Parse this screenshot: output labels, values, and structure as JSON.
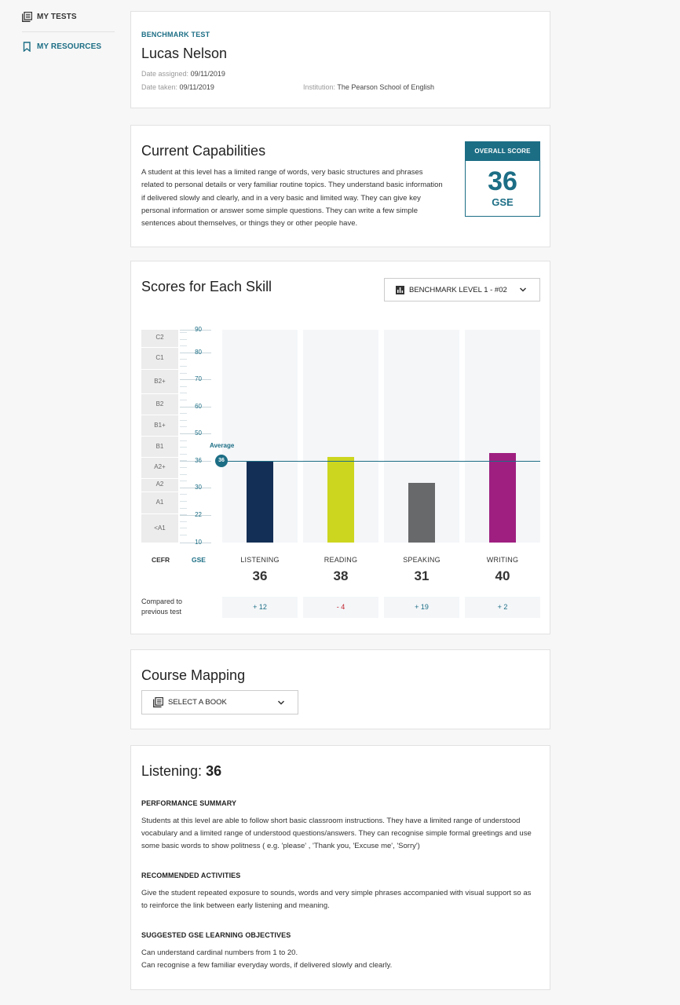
{
  "sidebar": {
    "items": [
      {
        "label": "MY TESTS"
      },
      {
        "label": "MY RESOURCES"
      }
    ]
  },
  "header": {
    "eyebrow": "BENCHMARK TEST",
    "student_name": "Lucas Nelson",
    "date_assigned_label": "Date assigned:",
    "date_assigned": "09/11/2019",
    "date_taken_label": "Date taken:",
    "date_taken": "09/11/2019",
    "institution_label": "Institution:",
    "institution": "The Pearson School of English"
  },
  "capabilities": {
    "title": "Current Capabilities",
    "text": "A student at this level has a limited range of words, very basic structures and phrases related to personal details or very familiar routine topics. They understand basic information if delivered slowly and clearly, and in a very basic and limited way. They can give key personal information or answer some simple questions. They can write a few simple sentences about themselves, or things they or other people have.",
    "overall_label": "OVERALL SCORE",
    "overall_score": "36",
    "overall_unit": "GSE"
  },
  "scores": {
    "title": "Scores for Each Skill",
    "selector_label": "BENCHMARK LEVEL 1 - #02",
    "cefr_axis_label": "CEFR",
    "gse_axis_label": "GSE",
    "compare_label_line1": "Compared to",
    "compare_label_line2": "previous test",
    "average_label": "Average",
    "average_value": "36",
    "cefr_levels": [
      "C2",
      "C1",
      "B2+",
      "B2",
      "B1+",
      "B1",
      "A2+",
      "A2",
      "A1",
      "<A1"
    ],
    "skills": [
      {
        "name": "LISTENING",
        "score": "36",
        "delta": "+ 12"
      },
      {
        "name": "READING",
        "score": "38",
        "delta": "- 4"
      },
      {
        "name": "SPEAKING",
        "score": "31",
        "delta": "+ 19"
      },
      {
        "name": "WRITING",
        "score": "40",
        "delta": "+ 2"
      }
    ],
    "colors": {
      "accent": "#1c6e85",
      "listening": "#142f55",
      "reading": "#cdd61f",
      "speaking": "#68696b",
      "writing": "#9e1f80",
      "positive": "#1c6e85",
      "negative": "#c0262e"
    }
  },
  "chart_data": {
    "type": "bar",
    "categories": [
      "LISTENING",
      "READING",
      "SPEAKING",
      "WRITING"
    ],
    "values": [
      36,
      38,
      31,
      40
    ],
    "gse_ticks": [
      10,
      22,
      30,
      36,
      50,
      60,
      70,
      80,
      90
    ],
    "ylim": [
      10,
      90
    ],
    "average": 36
  },
  "course_mapping": {
    "title": "Course Mapping",
    "select_label": "SELECT A BOOK"
  },
  "listening": {
    "title_prefix": "Listening:",
    "title_score": "36",
    "performance_head": "PERFORMANCE SUMMARY",
    "performance_text": "Students at this level are able to follow short basic classroom instructions. They have a limited range of understood vocabulary and a limited range of understood questions/answers.  They can recognise simple formal greetings and use some basic words to show politness ( e.g. 'please' , 'Thank you, 'Excuse me', 'Sorry')",
    "activities_head": "RECOMMENDED ACTIVITIES",
    "activities_text": "Give the student repeated exposure to sounds, words and very simple phrases accompanied with visual support so as to reinforce the link between early listening and meaning.",
    "objectives_head": "SUGGESTED GSE LEARNING OBJECTIVES",
    "objectives": [
      "Can understand cardinal numbers from 1 to 20.",
      "Can recognise a few familiar everyday words, if delivered slowly and clearly."
    ]
  }
}
